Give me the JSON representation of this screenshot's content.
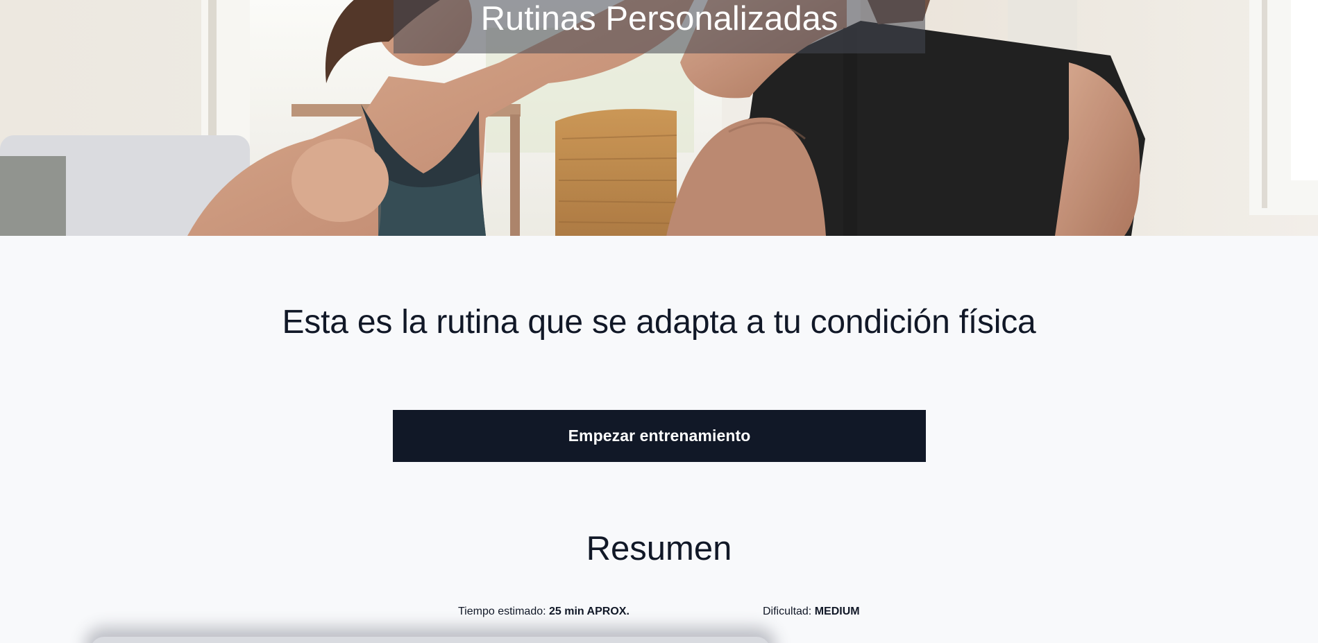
{
  "hero": {
    "title": "Rutinas Personalizadas"
  },
  "main": {
    "headline": "Esta es la rutina que se adapta a tu condición física",
    "start_button_label": "Empezar entrenamiento"
  },
  "summary": {
    "title": "Resumen",
    "time_label": "Tiempo estimado:",
    "time_value": "25 min APROX.",
    "difficulty_label": "Dificultad:",
    "difficulty_value": "MEDIUM"
  },
  "colors": {
    "primary": "#111827",
    "background": "#f8f9fb",
    "title_band": "#464854"
  }
}
